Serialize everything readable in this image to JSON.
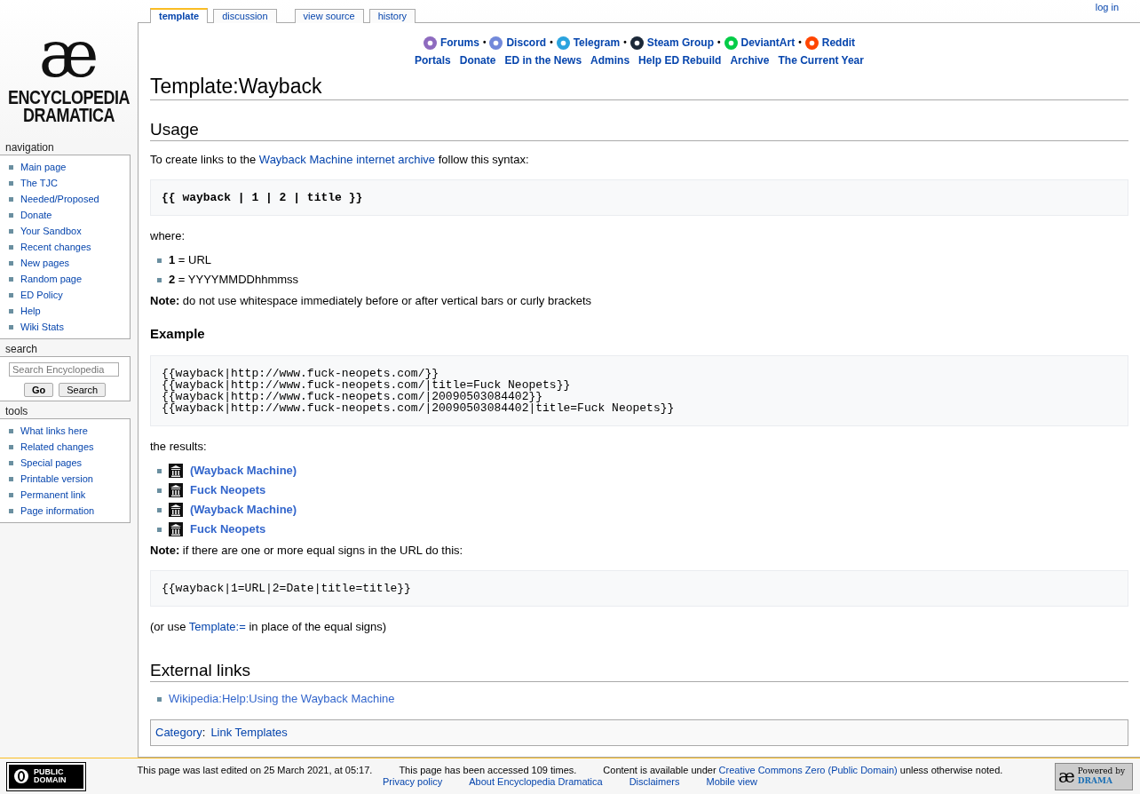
{
  "logo": {
    "mark": "æ",
    "lines": [
      "ENCYCLOPEDIA",
      "DRAMATICA"
    ]
  },
  "personal": [
    "log in"
  ],
  "tabs": [
    {
      "label": "template",
      "selected": true
    },
    {
      "label": "discussion",
      "selected": false
    },
    {
      "label": "view source",
      "selected": false
    },
    {
      "label": "history",
      "selected": false
    }
  ],
  "sidebar": [
    {
      "kind": "links",
      "title": "navigation",
      "items": [
        "Main page",
        "The TJC",
        "Needed/Proposed",
        "Donate",
        "Your Sandbox",
        "Recent changes",
        "New pages",
        "Random page",
        "ED Policy",
        "Help",
        "Wiki Stats"
      ]
    },
    {
      "kind": "search",
      "title": "search",
      "placeholder": "Search Encyclopedia",
      "buttons": [
        "Go",
        "Search"
      ]
    },
    {
      "kind": "links",
      "title": "tools",
      "items": [
        "What links here",
        "Related changes",
        "Special pages",
        "Printable version",
        "Permanent link",
        "Page information"
      ]
    }
  ],
  "community_separator": "•",
  "community": [
    {
      "label": "Forums",
      "color": "#8e6bbf"
    },
    {
      "label": "Discord",
      "color": "#7289da"
    },
    {
      "label": "Telegram",
      "color": "#2aa3de"
    },
    {
      "label": "Steam Group",
      "color": "#1b2838"
    },
    {
      "label": "DeviantArt",
      "color": "#05cc47"
    },
    {
      "label": "Reddit",
      "color": "#ff4500"
    }
  ],
  "site_links": [
    "Portals",
    "Donate",
    "ED in the News",
    "Admins",
    "Help ED Rebuild",
    "Archive",
    "The Current Year"
  ],
  "title": "Template:Wayback",
  "usage": {
    "heading": "Usage",
    "intro_before": "To create links to the ",
    "intro_link": "Wayback Machine internet archive",
    "intro_after": " follow this syntax:",
    "syntax": "{{ wayback | 1 | 2 | title }}",
    "where": "where:",
    "params": [
      "**1** = URL",
      "**2** = YYYYMMDDhhmmss"
    ],
    "note": "**Note:** do not use whitespace immediately before or after vertical bars or curly brackets"
  },
  "example": {
    "heading": "Example",
    "code": [
      "{{wayback|http://www.fuck-neopets.com/}}",
      "{{wayback|http://www.fuck-neopets.com/|title=Fuck Neopets}}",
      "{{wayback|http://www.fuck-neopets.com/|20090503084402}}",
      "{{wayback|http://www.fuck-neopets.com/|20090503084402|title=Fuck Neopets}}"
    ],
    "results_label": "the results:",
    "results": [
      "(Wayback Machine)",
      "Fuck Neopets",
      "(Wayback Machine)",
      "Fuck Neopets"
    ],
    "note": "**Note:** if there are one or more equal signs in the URL do this:",
    "code2": "{{wayback|1=URL|2=Date|title=title}}",
    "or_before": "(or use ",
    "or_link": "Template:=",
    "or_after": " in place of the equal signs)"
  },
  "external": {
    "heading": "External links",
    "links": [
      "Wikipedia:Help:Using the Wayback Machine"
    ]
  },
  "category": {
    "label": "Category",
    "colon": ":",
    "items": [
      "Link Templates"
    ]
  },
  "footer": {
    "badge": [
      "PUBLIC",
      "DOMAIN"
    ],
    "info": [
      "This page was last edited on 25 March 2021, at 05:17.",
      "This page has been accessed 109 times."
    ],
    "license_before": "Content is available under ",
    "license_link": "Creative Commons Zero (Public Domain)",
    "license_after": " unless otherwise noted.",
    "places": [
      "Privacy policy",
      "About Encyclopedia Dramatica",
      "Disclaimers",
      "Mobile view"
    ],
    "powered_mark": "æ",
    "powered": [
      "Powered by",
      "DRAMA"
    ]
  }
}
